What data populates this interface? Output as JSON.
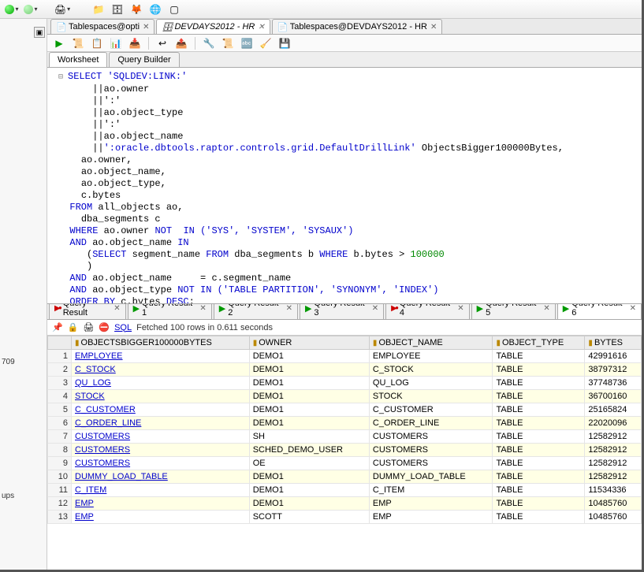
{
  "tabs": [
    {
      "label": "Tablespaces@opti",
      "active": false
    },
    {
      "label": "DEVDAYS2012 - HR",
      "active": true,
      "italic": true
    },
    {
      "label": "Tablespaces@DEVDAYS2012 - HR",
      "active": false
    }
  ],
  "ws_tabs": [
    {
      "label": "Worksheet",
      "active": true
    },
    {
      "label": "Query Builder",
      "active": false
    }
  ],
  "sql_lines": [
    {
      "t": "⊟",
      "cls": "gutter"
    },
    {
      "t": "SELECT 'SQLDEV:LINK:'",
      "cls": "line1"
    }
  ],
  "sql_text": {
    "kw_select": "SELECT",
    "lit1": "'SQLDEV:LINK:'",
    "p1": "||ao.owner",
    "p2": "||':' ",
    "p3": "||ao.object_type",
    "p4": "||':' ",
    "p5": "||ao.object_name",
    "lit2": "':oracle.dbtools.raptor.controls.grid.DefaultDrillLink'",
    "alias": " ObjectsBigger100000Bytes,",
    "c1": "ao.owner,",
    "c2": "ao.object_name,",
    "c3": "ao.object_type,",
    "c4": "c.bytes",
    "kw_from": "FROM",
    "from_txt": " all_objects ao,",
    "from2": "dba_segments c",
    "kw_where": "WHERE",
    "where1": " ao.owner ",
    "kw_not": "NOT",
    "kw_in": " IN ",
    "lits": "('SYS', 'SYSTEM', 'SYSAUX')",
    "kw_and": "AND",
    "and1": " ao.object_name ",
    "kw_in2": "IN",
    "sub_open": "(",
    "kw_select2": "SELECT",
    "sub_txt": " segment_name ",
    "kw_from2": "FROM",
    "sub_txt2": " dba_segments b ",
    "kw_where2": "WHERE",
    "sub_txt3": " b.bytes > ",
    "num1": "100000",
    "sub_close": ")",
    "and2": " ao.object_name     = c.segment_name",
    "and3": " ao.object_type ",
    "kw_not2": "NOT IN ",
    "lits2": "('TABLE PARTITION', 'SYNONYM', 'INDEX')",
    "kw_order": "ORDER BY",
    "ord": " c.bytes ",
    "kw_desc": "DESC",
    ";": ";"
  },
  "result_tabs": [
    {
      "label": "Query Result",
      "icon": "red"
    },
    {
      "label": "Query Result 1",
      "icon": "green"
    },
    {
      "label": "Query Result 2",
      "icon": "green"
    },
    {
      "label": "Query Result 3",
      "icon": "green"
    },
    {
      "label": "Query Result 4",
      "icon": "red"
    },
    {
      "label": "Query Result 5",
      "icon": "green"
    },
    {
      "label": "Query Result 6",
      "icon": "green",
      "active": true
    }
  ],
  "status": {
    "sql": "SQL",
    "msg": "Fetched 100 rows in 0.611 seconds"
  },
  "columns": [
    "OBJECTSBIGGER100000BYTES",
    "OWNER",
    "OBJECT_NAME",
    "OBJECT_TYPE",
    "BYTES"
  ],
  "rows": [
    {
      "n": 1,
      "link": "EMPLOYEE",
      "owner": "DEMO1",
      "obj": "EMPLOYEE",
      "type": "TABLE",
      "bytes": "42991616"
    },
    {
      "n": 2,
      "link": "C_STOCK",
      "owner": "DEMO1",
      "obj": "C_STOCK",
      "type": "TABLE",
      "bytes": "38797312"
    },
    {
      "n": 3,
      "link": "QU_LOG",
      "owner": "DEMO1",
      "obj": "QU_LOG",
      "type": "TABLE",
      "bytes": "37748736"
    },
    {
      "n": 4,
      "link": "STOCK",
      "owner": "DEMO1",
      "obj": "STOCK",
      "type": "TABLE",
      "bytes": "36700160"
    },
    {
      "n": 5,
      "link": "C_CUSTOMER",
      "owner": "DEMO1",
      "obj": "C_CUSTOMER",
      "type": "TABLE",
      "bytes": "25165824"
    },
    {
      "n": 6,
      "link": "C_ORDER_LINE",
      "owner": "DEMO1",
      "obj": "C_ORDER_LINE",
      "type": "TABLE",
      "bytes": "22020096"
    },
    {
      "n": 7,
      "link": "CUSTOMERS",
      "owner": "SH",
      "obj": "CUSTOMERS",
      "type": "TABLE",
      "bytes": "12582912"
    },
    {
      "n": 8,
      "link": "CUSTOMERS",
      "owner": "SCHED_DEMO_USER",
      "obj": "CUSTOMERS",
      "type": "TABLE",
      "bytes": "12582912"
    },
    {
      "n": 9,
      "link": "CUSTOMERS",
      "owner": "OE",
      "obj": "CUSTOMERS",
      "type": "TABLE",
      "bytes": "12582912"
    },
    {
      "n": 10,
      "link": "DUMMY_LOAD_TABLE",
      "owner": "DEMO1",
      "obj": "DUMMY_LOAD_TABLE",
      "type": "TABLE",
      "bytes": "12582912"
    },
    {
      "n": 11,
      "link": "C_ITEM",
      "owner": "DEMO1",
      "obj": "C_ITEM",
      "type": "TABLE",
      "bytes": "11534336"
    },
    {
      "n": 12,
      "link": "EMP",
      "owner": "DEMO1",
      "obj": "EMP",
      "type": "TABLE",
      "bytes": "10485760"
    },
    {
      "n": 13,
      "link": "EMP",
      "owner": "SCOTT",
      "obj": "EMP",
      "type": "TABLE",
      "bytes": "10485760"
    }
  ],
  "left": {
    "t1": "709",
    "t2": "ups"
  }
}
